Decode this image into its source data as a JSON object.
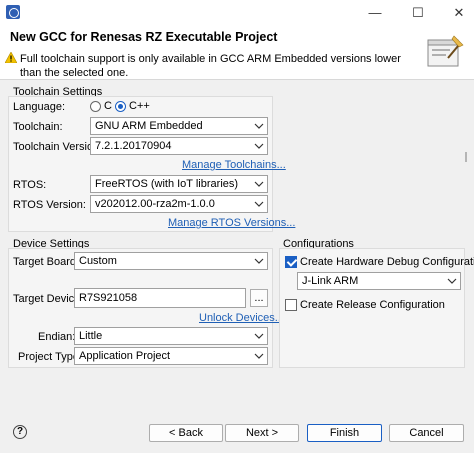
{
  "titlebar": {
    "minimize_glyph": "—",
    "maximize_glyph": "☐",
    "close_glyph": "✕"
  },
  "header": {
    "title": "New GCC for Renesas RZ Executable Project",
    "message": "Full toolchain support is only available in GCC ARM Embedded versions lower than the selected one."
  },
  "toolchain_settings": {
    "group_title": "Toolchain Settings",
    "language_label": "Language:",
    "language_options": [
      "C",
      "C++"
    ],
    "language_selected": "C++",
    "toolchain_label": "Toolchain:",
    "toolchain_value": "GNU ARM Embedded",
    "toolchain_version_label": "Toolchain Version:",
    "toolchain_version_value": "7.2.1.20170904",
    "manage_toolchains_link": "Manage Toolchains...",
    "rtos_label": "RTOS:",
    "rtos_value": "FreeRTOS (with IoT libraries)",
    "rtos_version_label": "RTOS Version:",
    "rtos_version_value": "v202012.00-rza2m-1.0.0",
    "manage_rtos_link": "Manage RTOS Versions..."
  },
  "device_settings": {
    "group_title": "Device Settings",
    "target_board_label": "Target Board:",
    "target_board_value": "Custom",
    "target_device_label": "Target Device:",
    "target_device_value": "R7S921058",
    "browse_label": "...",
    "unlock_devices_link": "Unlock Devices...",
    "endian_label": "Endian:",
    "endian_value": "Little",
    "project_type_label": "Project Type:",
    "project_type_value": "Application Project"
  },
  "configurations": {
    "group_title": "Configurations",
    "hw_debug_label": "Create Hardware Debug Configuration",
    "hw_debug_checked": true,
    "debugger_value": "J-Link ARM",
    "release_label": "Create Release Configuration",
    "release_checked": false
  },
  "footer": {
    "help_glyph": "?",
    "back_label": "< Back",
    "next_label": "Next >",
    "finish_label": "Finish",
    "cancel_label": "Cancel"
  },
  "colors": {
    "accent": "#1a5fc4",
    "link": "#1f5fb5",
    "dialog_bg": "#f0f0f0"
  }
}
